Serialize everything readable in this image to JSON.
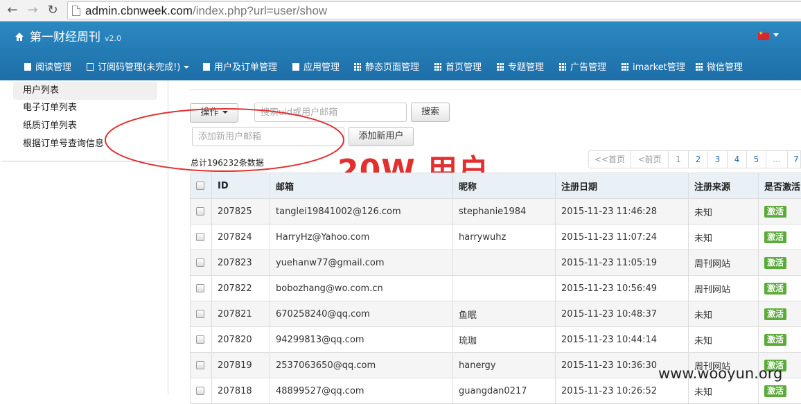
{
  "browser": {
    "url_host": "admin.cbnweek.com",
    "url_path": "/index.php?url=user/show"
  },
  "header": {
    "brand": "第一财经周刊",
    "version": "v2.0"
  },
  "menu": [
    {
      "label": "阅读管理",
      "icon": "document-icon"
    },
    {
      "label": "订阅码管理(未完成!)",
      "icon": "list-icon",
      "dropdown": true
    },
    {
      "label": "用户及订单管理",
      "icon": "document-icon"
    },
    {
      "label": "应用管理",
      "icon": "document-icon"
    },
    {
      "label": "静态页面管理",
      "icon": "grid-icon"
    },
    {
      "label": "首页管理",
      "icon": "grid-icon"
    },
    {
      "label": "专题管理",
      "icon": "grid-icon"
    },
    {
      "label": "广告管理",
      "icon": "grid-icon"
    },
    {
      "label": "imarket管理",
      "icon": "grid-icon"
    },
    {
      "label": "微信管理",
      "icon": "grid-icon"
    }
  ],
  "sidebar": {
    "items": [
      {
        "label": "用户列表",
        "active": true
      },
      {
        "label": "电子订单列表"
      },
      {
        "label": "纸质订单列表"
      },
      {
        "label": "根据订单号查询信息"
      }
    ]
  },
  "toolbar": {
    "actions_label": "操作",
    "search_placeholder": "搜索uid或用户邮箱",
    "search_label": "搜索",
    "add_placeholder": "添加新用户邮箱",
    "add_label": "添加新用户"
  },
  "total_text": "总计196232条数据",
  "annotation": "20W 用户",
  "pagination": [
    "<<首页",
    "<前页",
    "1",
    "2",
    "3",
    "4",
    "5",
    "...",
    "7"
  ],
  "table": {
    "headers": [
      "ID",
      "邮箱",
      "昵称",
      "注册日期",
      "注册来源",
      "是否激活"
    ],
    "rows": [
      {
        "id": "207825",
        "email": "tanglei19841002@126.com",
        "nick": "stephanie1984",
        "date": "2015-11-23 11:46:28",
        "source": "未知",
        "status": "激活"
      },
      {
        "id": "207824",
        "email": "HarryHz@Yahoo.com",
        "nick": "harrywuhz",
        "date": "2015-11-23 11:07:24",
        "source": "未知",
        "status": "激活"
      },
      {
        "id": "207823",
        "email": "yuehanw77@gmail.com",
        "nick": "",
        "date": "2015-11-23 11:05:19",
        "source": "周刊网站",
        "status": "激活"
      },
      {
        "id": "207822",
        "email": "bobozhang@wo.com.cn",
        "nick": "",
        "date": "2015-11-23 10:56:49",
        "source": "周刊网站",
        "status": "激活"
      },
      {
        "id": "207821",
        "email": "670258240@qq.com",
        "nick": "鱼眠",
        "date": "2015-11-23 10:48:37",
        "source": "未知",
        "status": "激活"
      },
      {
        "id": "207820",
        "email": "94299813@qq.com",
        "nick": "琉珈",
        "date": "2015-11-23 10:44:14",
        "source": "未知",
        "status": "激活"
      },
      {
        "id": "207819",
        "email": "2537063650@qq.com",
        "nick": "hanergy",
        "date": "2015-11-23 10:36:30",
        "source": "周刊网站",
        "status": "激活"
      },
      {
        "id": "207818",
        "email": "48899527@qq.com",
        "nick": "guangdan0217",
        "date": "2015-11-23 10:26:52",
        "source": "未知",
        "status": "激活"
      }
    ]
  },
  "watermark": "www.wooyun.org",
  "colors": {
    "header_top": "#2c89c1",
    "header_bottom": "#1d6ea8",
    "annotation_red": "#e23030",
    "badge_green": "#5bab3a"
  }
}
